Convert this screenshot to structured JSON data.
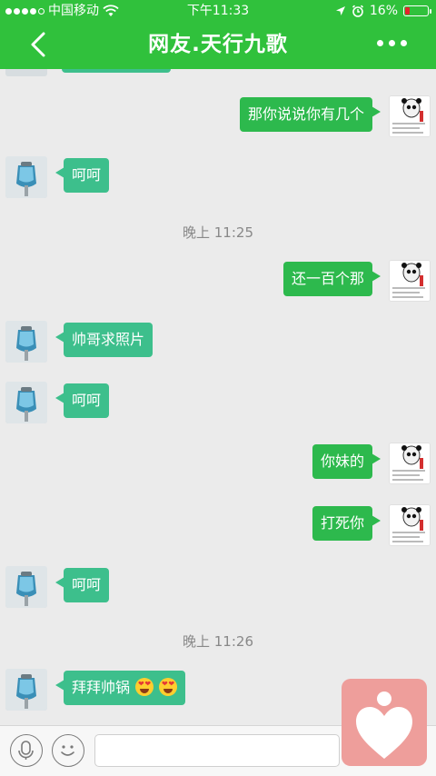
{
  "status_bar": {
    "carrier": "中国移动",
    "time": "下午11:33",
    "battery": "16%",
    "battery_level": 0.16
  },
  "header": {
    "title": "网友.天行九歌"
  },
  "messages": [
    {
      "side": "me",
      "text": "那你说说你有几个"
    },
    {
      "side": "friend",
      "text": "呵呵"
    },
    {
      "type": "time",
      "text": "晚上 11:25"
    },
    {
      "side": "me",
      "text": "还一百个那"
    },
    {
      "side": "friend",
      "text": "帅哥求照片"
    },
    {
      "side": "friend",
      "text": "呵呵"
    },
    {
      "side": "me",
      "text": "你妹的"
    },
    {
      "side": "me",
      "text": "打死你"
    },
    {
      "side": "friend",
      "text": "呵呵"
    },
    {
      "type": "time",
      "text": "晚上 11:26"
    },
    {
      "side": "friend",
      "text": "拜拜帅锅",
      "emoji": "heart-eyes-emoji"
    }
  ],
  "input": {
    "placeholder": ""
  },
  "colors": {
    "header_bg": "#30c13c",
    "friend_bubble": "#3dbf8c",
    "my_bubble": "#2db94d",
    "floating_button": "#ee9e9b"
  }
}
